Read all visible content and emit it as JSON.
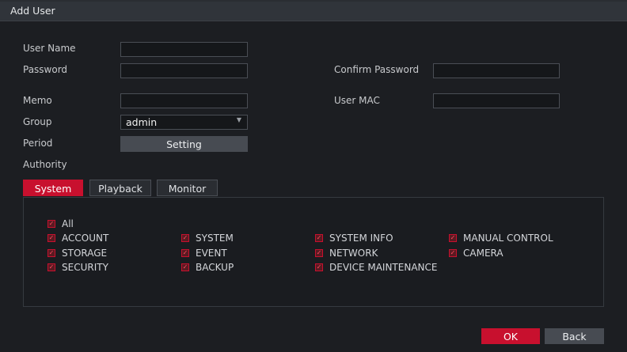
{
  "window": {
    "title": "Add User"
  },
  "form": {
    "username_label": "User Name",
    "password_label": "Password",
    "confirm_password_label": "Confirm Password",
    "memo_label": "Memo",
    "user_mac_label": "User MAC",
    "group_label": "Group",
    "group_value": "admin",
    "period_label": "Period",
    "setting_label": "Setting",
    "authority_label": "Authority"
  },
  "tabs": [
    {
      "label": "System",
      "active": true
    },
    {
      "label": "Playback",
      "active": false
    },
    {
      "label": "Monitor",
      "active": false
    }
  ],
  "permissions": {
    "all": "All",
    "items": [
      "ACCOUNT",
      "SYSTEM",
      "SYSTEM INFO",
      "MANUAL CONTROL",
      "STORAGE",
      "EVENT",
      "NETWORK",
      "CAMERA",
      "SECURITY",
      "BACKUP",
      "DEVICE MAINTENANCE"
    ]
  },
  "footer": {
    "ok_label": "OK",
    "back_label": "Back"
  },
  "colors": {
    "accent": "#c8102e",
    "background": "#1c1e22",
    "panel": "#1a1c20"
  }
}
